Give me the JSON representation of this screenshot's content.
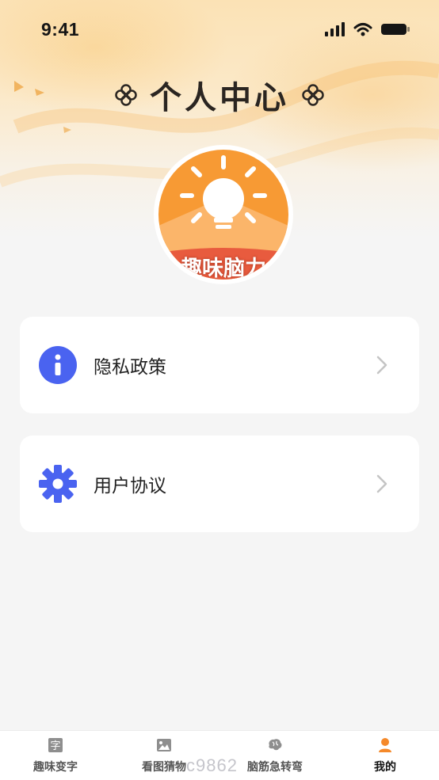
{
  "status_bar": {
    "time": "9:41"
  },
  "header": {
    "title": "个人中心"
  },
  "avatar": {
    "text": "趣味脑力"
  },
  "menu": [
    {
      "label": "隐私政策",
      "icon": "info-icon",
      "color": "#4a63f0"
    },
    {
      "label": "用户协议",
      "icon": "gear-icon",
      "color": "#4a63f0"
    }
  ],
  "tabbar": {
    "tabs": [
      {
        "label": "趣味变字",
        "icon": "char-icon",
        "active": false
      },
      {
        "label": "看图猜物",
        "icon": "image-icon",
        "active": false
      },
      {
        "label": "脑筋急转弯",
        "icon": "brain-icon",
        "active": false
      },
      {
        "label": "我的",
        "icon": "person-icon",
        "active": true
      }
    ],
    "active_color": "#f5892a"
  },
  "watermark": "c9862"
}
